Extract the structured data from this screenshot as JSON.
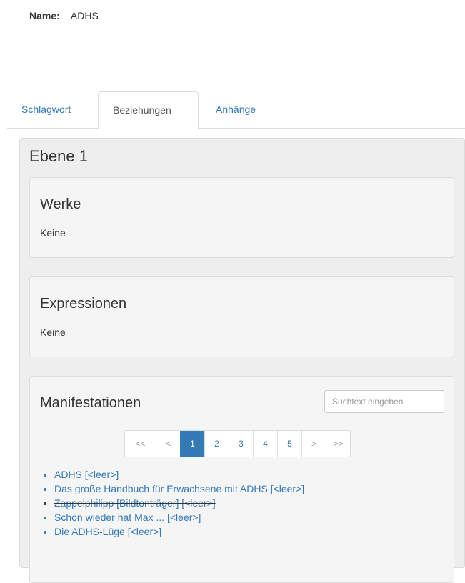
{
  "header": {
    "name_label": "Name:",
    "name_value": "ADHS"
  },
  "tabs": [
    {
      "label": "Schlagwort",
      "active": false
    },
    {
      "label": "Beziehungen",
      "active": true
    },
    {
      "label": "Anhänge",
      "active": false
    }
  ],
  "ebene": {
    "title": "Ebene 1",
    "werke": {
      "title": "Werke",
      "empty": "Keine"
    },
    "expressionen": {
      "title": "Expressionen",
      "empty": "Keine"
    },
    "manifestationen": {
      "title": "Manifestationen",
      "search_placeholder": "Suchtext eingeben",
      "pagination": [
        "<<",
        "<",
        "1",
        "2",
        "3",
        "4",
        "5",
        ">",
        ">>"
      ],
      "current_page": "1",
      "items": [
        {
          "text": "ADHS [<leer>]",
          "struck": false
        },
        {
          "text": "Das große Handbuch für Erwachsene mit ADHS [<leer>]",
          "struck": false
        },
        {
          "text": "Zappelphilipp [Bildtonträger] [<leer>]",
          "struck": true
        },
        {
          "text": "Schon wieder hat Max ... [<leer>]",
          "struck": false
        },
        {
          "text": "Die ADHS-Lüge [<leer>]",
          "struck": false
        }
      ]
    }
  },
  "colors": {
    "link": "#337ab7",
    "active_page_bg": "#337ab7",
    "well_bg": "#eeeeee"
  }
}
